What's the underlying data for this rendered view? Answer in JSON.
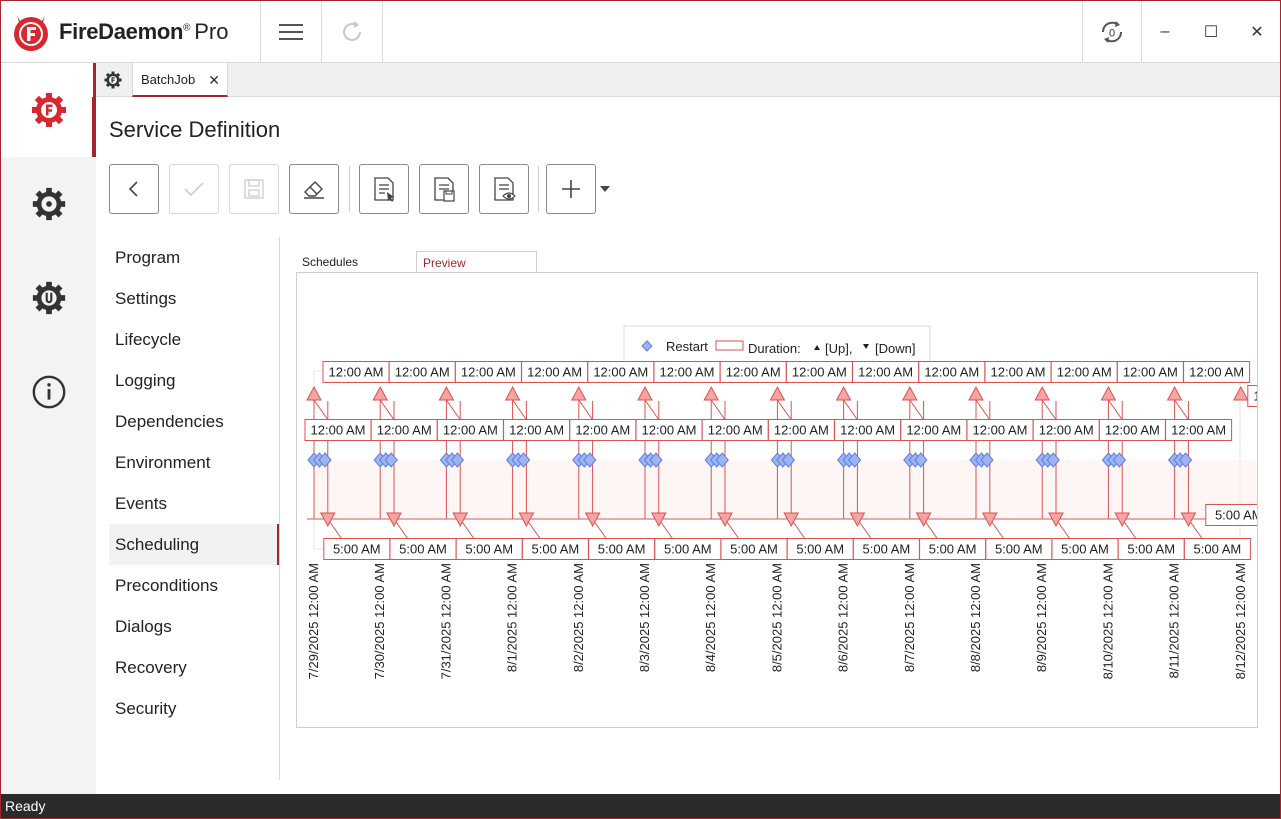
{
  "app": {
    "brand": "FireDaemon",
    "brand_reg": "®",
    "brand_edition": "Pro",
    "brand_color": "#d8282e",
    "accent_color": "#a4262c"
  },
  "titlebar": {
    "icons": [
      "hamburger-icon",
      "refresh-icon",
      "service-status-icon"
    ],
    "window_controls": {
      "minimize": "–",
      "maximize": "☐",
      "close": "✕"
    }
  },
  "rail": {
    "items": [
      "firedaemon-services-icon",
      "settings-gear-icon",
      "utilities-icon",
      "info-icon"
    ]
  },
  "tabs": {
    "home_icon": "service-gear-icon",
    "open_tab": "BatchJob",
    "close_glyph": "✕"
  },
  "page": {
    "title": "Service Definition"
  },
  "toolbar": {
    "buttons": [
      "back-icon",
      "check-icon",
      "save-icon",
      "eraser-icon",
      "edit-definition-icon",
      "save-definition-icon",
      "preview-definition-icon",
      "add-icon"
    ]
  },
  "sidenav": {
    "items": [
      "Program",
      "Settings",
      "Lifecycle",
      "Logging",
      "Dependencies",
      "Environment",
      "Events",
      "Scheduling",
      "Preconditions",
      "Dialogs",
      "Recovery",
      "Security"
    ],
    "active": "Scheduling"
  },
  "schedule_tabs": {
    "schedules": "Schedules",
    "preview": "Preview"
  },
  "chart_data": {
    "type": "scatter",
    "legend": {
      "restart": "Restart",
      "duration": "Duration:",
      "up": "[Up],",
      "down": "[Down]",
      "placement": "top-center"
    },
    "up_label": "12:00 AM",
    "down_label": "5:00 AM",
    "x_tick_labels": [
      "7/29/2025 12:00 AM",
      "7/30/2025 12:00 AM",
      "7/31/2025 12:00 AM",
      "8/1/2025 12:00 AM",
      "8/2/2025 12:00 AM",
      "8/3/2025 12:00 AM",
      "8/4/2025 12:00 AM",
      "8/5/2025 12:00 AM",
      "8/6/2025 12:00 AM",
      "8/7/2025 12:00 AM",
      "8/8/2025 12:00 AM",
      "8/9/2025 12:00 AM",
      "8/10/2025 12:00 AM",
      "8/11/2025 12:00 AM",
      "8/12/2025 12:00 AM"
    ],
    "up_events": [
      "7/29/2025 12:00 AM",
      "7/30/2025 12:00 AM",
      "7/31/2025 12:00 AM",
      "8/1/2025 12:00 AM",
      "8/2/2025 12:00 AM",
      "8/3/2025 12:00 AM",
      "8/4/2025 12:00 AM",
      "8/5/2025 12:00 AM",
      "8/6/2025 12:00 AM",
      "8/7/2025 12:00 AM",
      "8/8/2025 12:00 AM",
      "8/9/2025 12:00 AM",
      "8/10/2025 12:00 AM",
      "8/11/2025 12:00 AM",
      "8/12/2025 12:00 AM"
    ],
    "down_events": [
      "7/29/2025 5:00 AM",
      "7/30/2025 5:00 AM",
      "7/31/2025 5:00 AM",
      "8/1/2025 5:00 AM",
      "8/2/2025 5:00 AM",
      "8/3/2025 5:00 AM",
      "8/4/2025 5:00 AM",
      "8/5/2025 5:00 AM",
      "8/6/2025 5:00 AM",
      "8/7/2025 5:00 AM",
      "8/8/2025 5:00 AM",
      "8/9/2025 5:00 AM",
      "8/10/2025 5:00 AM",
      "8/11/2025 5:00 AM"
    ],
    "restarts_per_day": 3,
    "colors": {
      "duration": "#d9534f",
      "duration_fill": "#f5a3a3",
      "restart": "#5b7fe0",
      "restart_fill": "#9db3f2"
    }
  },
  "status": {
    "text": "Ready"
  }
}
